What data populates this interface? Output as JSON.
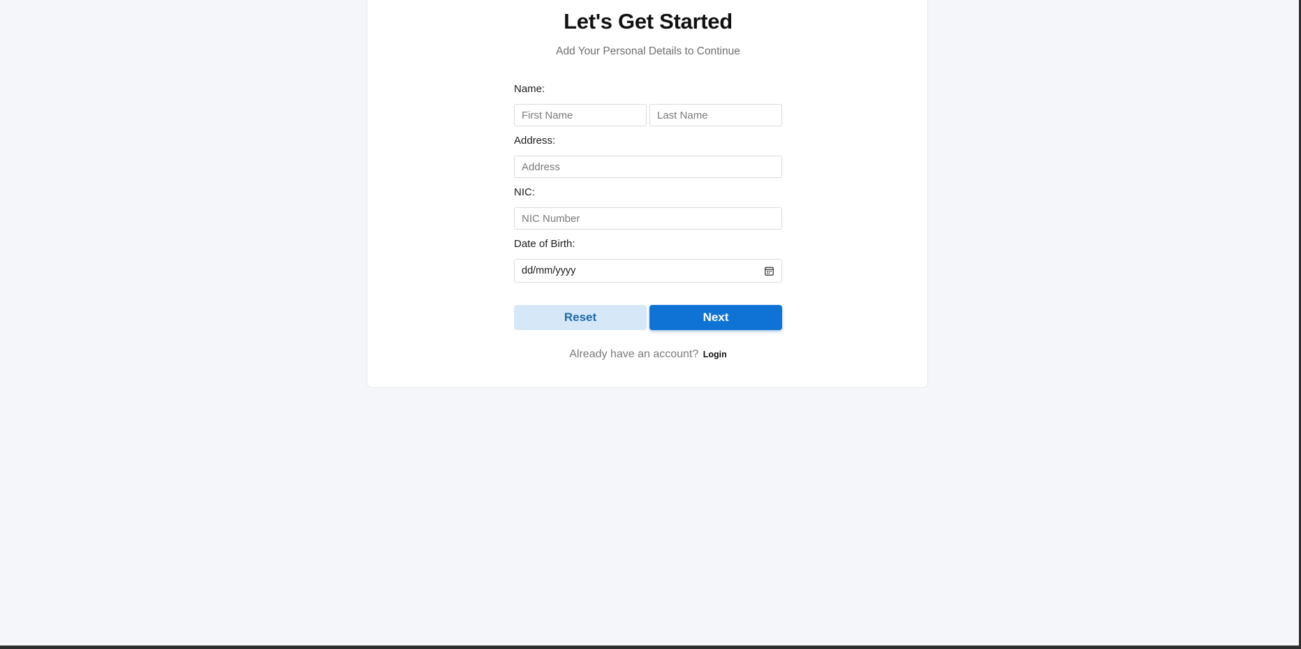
{
  "page": {
    "title": "Let's Get Started",
    "subtitle": "Add Your Personal Details to Continue"
  },
  "form": {
    "name_label": "Name:",
    "first_name_placeholder": "First Name",
    "last_name_placeholder": "Last Name",
    "address_label": "Address:",
    "address_placeholder": "Address",
    "nic_label": "NIC:",
    "nic_placeholder": "NIC Number",
    "dob_label": "Date of Birth:",
    "dob_placeholder": "dd/mm/yyyy",
    "dob_icon": "calendar-icon"
  },
  "actions": {
    "reset_label": "Reset",
    "next_label": "Next"
  },
  "footer": {
    "prompt": "Already have an account?",
    "login_label": "Login"
  },
  "colors": {
    "background": "#f4f6f9",
    "card": "#ffffff",
    "primary": "#0f73d6",
    "reset_bg": "#d6e8f8",
    "reset_text": "#1f6aa8"
  }
}
